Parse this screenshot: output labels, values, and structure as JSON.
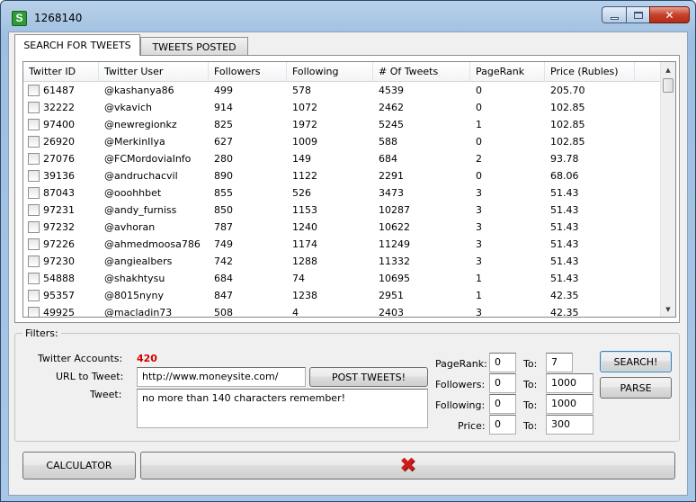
{
  "window": {
    "title": "1268140",
    "icon_letter": "S",
    "controls": {
      "minimize": "",
      "maximize": "",
      "close": "✕"
    }
  },
  "tabs": [
    {
      "label": "SEARCH FOR TWEETS",
      "active": true
    },
    {
      "label": "TWEETS POSTED",
      "active": false
    }
  ],
  "table": {
    "columns": [
      "Twitter ID",
      "Twitter User",
      "Followers",
      "Following",
      "# Of Tweets",
      "PageRank",
      "Price (Rubles)"
    ],
    "rows": [
      [
        "61487",
        "@kashanya86",
        "499",
        "578",
        "4539",
        "0",
        "205.70"
      ],
      [
        "32222",
        "@vkavich",
        "914",
        "1072",
        "2462",
        "0",
        "102.85"
      ],
      [
        "97400",
        "@newregionkz",
        "825",
        "1972",
        "5245",
        "1",
        "102.85"
      ],
      [
        "26920",
        "@MerkinIlya",
        "627",
        "1009",
        "588",
        "0",
        "102.85"
      ],
      [
        "27076",
        "@FCMordoviaInfo",
        "280",
        "149",
        "684",
        "2",
        "93.78"
      ],
      [
        "39136",
        "@andruchacvil",
        "890",
        "1122",
        "2291",
        "0",
        "68.06"
      ],
      [
        "87043",
        "@ooohhbet",
        "855",
        "526",
        "3473",
        "3",
        "51.43"
      ],
      [
        "97231",
        "@andy_furniss",
        "850",
        "1153",
        "10287",
        "3",
        "51.43"
      ],
      [
        "97232",
        "@avhoran",
        "787",
        "1240",
        "10622",
        "3",
        "51.43"
      ],
      [
        "97226",
        "@ahmedmoosa786",
        "749",
        "1174",
        "11249",
        "3",
        "51.43"
      ],
      [
        "97230",
        "@angiealbers",
        "742",
        "1288",
        "11332",
        "3",
        "51.43"
      ],
      [
        "54888",
        "@shakhtysu",
        "684",
        "74",
        "10695",
        "1",
        "51.43"
      ],
      [
        "95357",
        "@8015nyny",
        "847",
        "1238",
        "2951",
        "1",
        "42.35"
      ],
      [
        "49925",
        "@macladin73",
        "508",
        "4",
        "2403",
        "3",
        "42.35"
      ]
    ]
  },
  "filters": {
    "title": "Filters:",
    "accounts_label": "Twitter Accounts:",
    "accounts_count": "420",
    "url_label": "URL to Tweet:",
    "url_value": "http://www.moneysite.com/",
    "post_button": "POST TWEETS!",
    "tweet_label": "Tweet:",
    "tweet_value": "no more than 140 characters remember!",
    "to_label": "To:",
    "pagerank": {
      "label": "PageRank:",
      "from": "0",
      "to": "7"
    },
    "followers": {
      "label": "Followers:",
      "from": "0",
      "to": "1000"
    },
    "following": {
      "label": "Following:",
      "from": "0",
      "to": "1000"
    },
    "price": {
      "label": "Price:",
      "from": "0",
      "to": "300"
    },
    "search_button": "SEARCH!",
    "parse_button": "PARSE"
  },
  "bottom": {
    "calculator_button": "CALCULATOR",
    "cancel_icon": "red-x-icon"
  },
  "colors": {
    "accounts_count": "#d00000",
    "cancel_icon": "#cf1b1b"
  }
}
